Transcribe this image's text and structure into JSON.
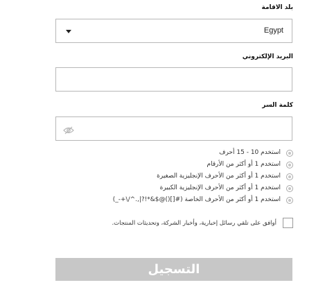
{
  "form": {
    "country_label": "بلد الاقامة",
    "country_value": "Egypt",
    "email_label": "البريد الإلكتروني",
    "email_value": "",
    "password_label": "كلمة السر",
    "password_value": "",
    "password_rules": [
      "استخدم 10 - 15 أحرف",
      "استخدم 1 أو أكثر من الأرقام",
      "استخدم 1 أو أكثر من الأحرف الإنجليزية الصغيرة",
      "استخدم 1 أو أكثر من الأحرف الإنجليزية الكبيرة",
      "استخدم 1 أو أكثر من الأحرف الخاصة (#[]()@$&*!?|,.^/\\+-_)"
    ],
    "consent_text": "أوافق على تلقي رسائل إخبارية، وأخبار الشركة، وتحديثات المنتجات.",
    "consent_checked": false,
    "submit_label": "التسجيل"
  },
  "icons": {
    "country_dropdown": "caret-down-icon",
    "password_toggle": "eye-slash-icon",
    "rule_status": "radio-dot-icon"
  },
  "colors": {
    "submit_disabled_bg": "#c7c7c7",
    "field_border": "#b7b7b7",
    "rule_dot": "#c5c5c5"
  }
}
